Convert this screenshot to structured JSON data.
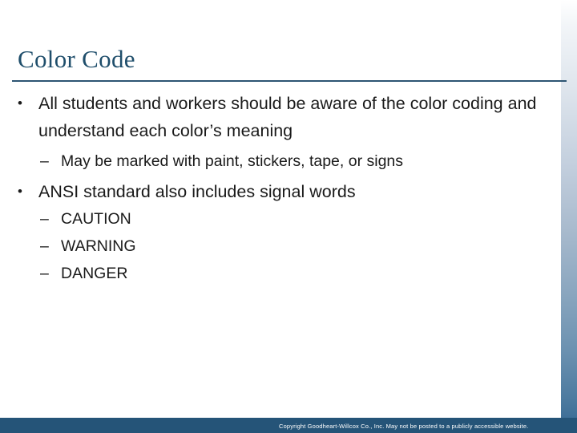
{
  "slide": {
    "title": "Color Code",
    "accent_color": "#1f4e6b",
    "rule_color": "#2d5573",
    "footer_band_color": "#255478",
    "body": [
      {
        "level": 1,
        "marker": "•",
        "text": "All students and workers should be aware of the color coding and understand each color’s meaning"
      },
      {
        "level": 2,
        "marker": "–",
        "text": "May be marked with paint, stickers, tape, or signs"
      },
      {
        "level": 1,
        "marker": "•",
        "text": "ANSI standard also includes signal words"
      },
      {
        "level": 2,
        "marker": "–",
        "text": "CAUTION"
      },
      {
        "level": 2,
        "marker": "–",
        "text": "WARNING"
      },
      {
        "level": 2,
        "marker": "–",
        "text": "DANGER"
      }
    ],
    "footer": {
      "copyright": "Copyright Goodheart-Willcox Co., Inc.  May not be posted to a publicly accessible website."
    }
  }
}
